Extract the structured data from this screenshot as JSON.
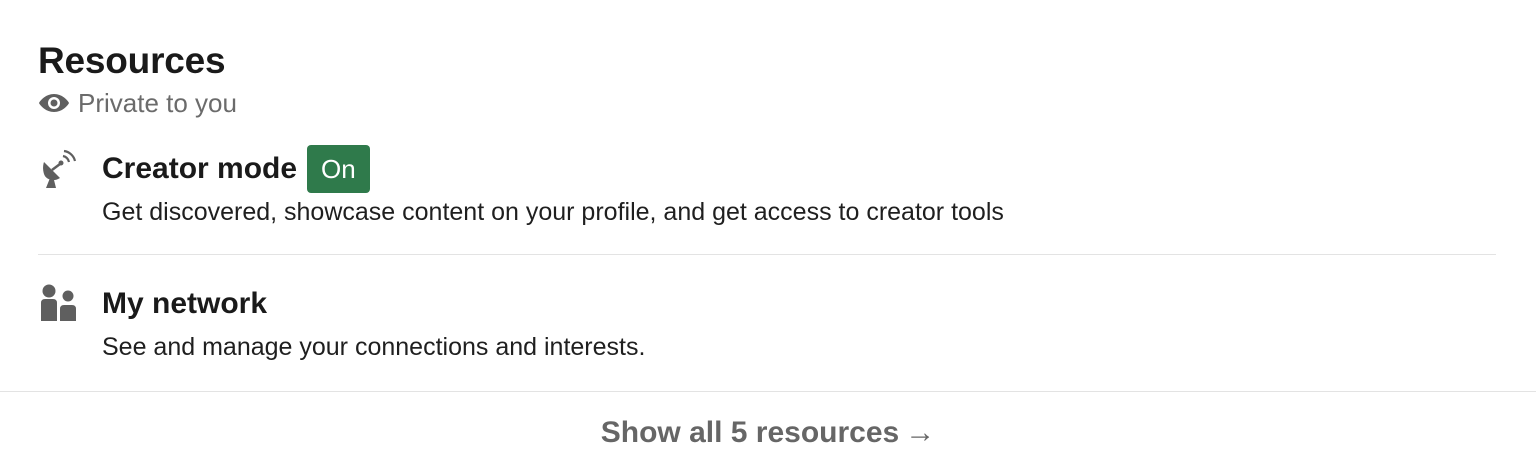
{
  "header": {
    "title": "Resources",
    "privacy_label": "Private to you"
  },
  "resources": [
    {
      "title": "Creator mode",
      "badge": "On",
      "description": "Get discovered, showcase content on your profile, and get access to creator tools",
      "icon": "satellite-dish-icon"
    },
    {
      "title": "My network",
      "description": "See and manage your connections and interests.",
      "icon": "people-icon"
    }
  ],
  "footer": {
    "show_all_label": "Show all 5 resources",
    "arrow": "→"
  },
  "colors": {
    "badge_bg": "#2f7a4b",
    "muted_text": "#6b6b6b",
    "icon_gray": "#5f5f5f",
    "divider": "#e3e3e3"
  }
}
